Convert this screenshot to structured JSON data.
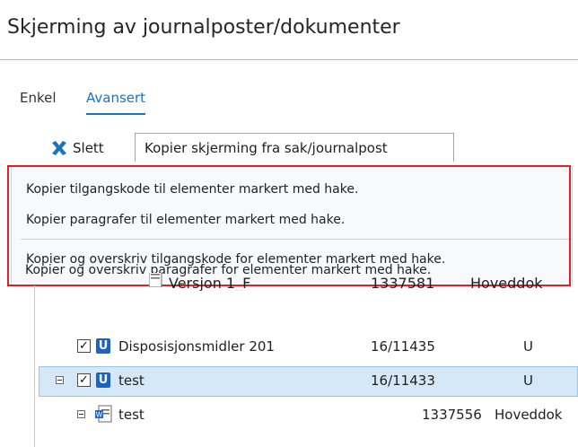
{
  "page": {
    "title": "Skjerming av journalposter/dokumenter"
  },
  "tabs": [
    {
      "label": "Enkel",
      "active": false
    },
    {
      "label": "Avansert",
      "active": true
    }
  ],
  "toolbar": {
    "delete_label": "Slett",
    "copy_label": "Kopier skjerming fra sak/journalpost"
  },
  "menu": {
    "items": [
      "Kopier tilgangskode til elementer markert med hake.",
      "Kopier paragrafer til elementer markert med hake.",
      "Kopier og overskriv tilgangskode for elementer markert med hake.",
      "Kopier og overskriv paragrafer for elementer markert med hake."
    ]
  },
  "tree": {
    "partial_row": {
      "title": "Versjon 1_F",
      "number": "1337581",
      "type": "Hoveddok"
    },
    "rows": [
      {
        "title": "Disposisjonsmidler 201",
        "number": "16/11435",
        "type": "U",
        "checked": true,
        "selected": false,
        "expandable": false
      },
      {
        "title": "test",
        "number": "16/11433",
        "type": "U",
        "checked": true,
        "selected": true,
        "expandable": true
      },
      {
        "title": "test",
        "number": "1337556",
        "type": "Hoveddok",
        "checked": false,
        "selected": false,
        "expandable": true
      }
    ],
    "u_icon_letter": "U",
    "check_mark": "✓"
  },
  "colors": {
    "accent": "#1e73be",
    "delete_icon": "#1e73be",
    "highlight_border": "#e01f26",
    "selection": "#d5e8f7",
    "u_icon": "#1c63c6"
  }
}
